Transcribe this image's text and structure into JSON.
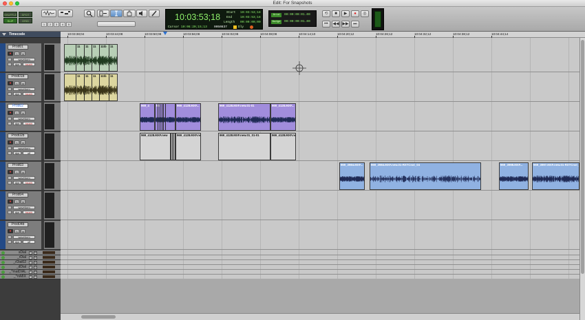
{
  "window": {
    "title": "Edit: For Snapshots"
  },
  "toolbar": {
    "modes": [
      "SHUFFLE",
      "SPOT",
      "SLIP",
      "GRID"
    ],
    "num_buttons": [
      "1",
      "2",
      "3",
      "4",
      "5"
    ],
    "counter": "10:03:53;18",
    "start_label": "Start",
    "end_label": "End",
    "length_label": "Length",
    "start_val": "10:03:53;18",
    "end_val": "10:03:53;18",
    "length_val": "00:00:00;00",
    "cursor_label": "Cursor",
    "cursor_val": "10:06:20;15;13",
    "cursor_sample": "0050837",
    "dly_label": "Dly",
    "grid_label": "Grid",
    "nudge_label": "Nudge",
    "grid_val": "00:00:00:01.00",
    "nudge_val": "00:00:00:01.00"
  },
  "ruler": {
    "header": "Timecode",
    "ticks": [
      "10:03:38;04",
      "10:03:44;08",
      "10:03:50;08",
      "10:03:56;08",
      "10:04:02;08",
      "10:04:08;08",
      "10:04:14;10",
      "10:04:20;12",
      "10:04:26;12",
      "10:04:32;12",
      "10:04:38;12",
      "10:04:44;14"
    ]
  },
  "track_labels": {
    "waveform": "waveform",
    "dyn": "dyn",
    "touch": "touch",
    "off": "off",
    "s": "S",
    "m": "M"
  },
  "tracks": [
    {
      "name": "Prod01",
      "auto": "touch"
    },
    {
      "name": "Prod01b",
      "auto": "touch"
    },
    {
      "name": "Prod02",
      "auto": "touch"
    },
    {
      "name": "Prod02b",
      "auto": "off"
    },
    {
      "name": "Prod03",
      "auto": "touch"
    },
    {
      "name": "Prod04",
      "auto": "touch"
    },
    {
      "name": "Prod04b",
      "auto": "off"
    }
  ],
  "mini_tracks": [
    "sDial",
    "_rDial",
    "_rDial02",
    "_dDial",
    "_^matDIAL",
    "_^mMIX"
  ],
  "clips": {
    "prod01": [
      "11",
      "11",
      "11",
      "11tb",
      "11"
    ],
    "prod01b": [
      "11",
      "11",
      "11",
      "11tb",
      "11"
    ],
    "prod02_a": "969_4",
    "prod02_b": "96",
    "prod02_c": "969_4128.MXF...",
    "prod02_d": "969_4128.MXF.new.01-01",
    "prod02_e": "969_4128.MXF...",
    "prod02b_a": "969_4128.MXF.new",
    "prod02b_b": "969_4128.MXF.new",
    "prod02b_c": "969_4128.MXF.new.01_01-01",
    "prod02b_d": "969_4128.MXF.new",
    "prod03_a": "969_3984.MXF...",
    "prod03_b": "969_3984.MXF.new.01-RXTCnxt_04",
    "prod03_c": "969_3998.MXF...",
    "prod03_d": "969_3997.MXF.new.01-RXTCnxt_04"
  },
  "colors": {
    "purple_clip": "#a18ddc",
    "blue_clip": "#90b2e2",
    "green_clip": "#b8cfb6",
    "yellow_clip": "#dcd69f",
    "waveform": "#1f2a55",
    "lcd_green": "#8ff26b"
  }
}
